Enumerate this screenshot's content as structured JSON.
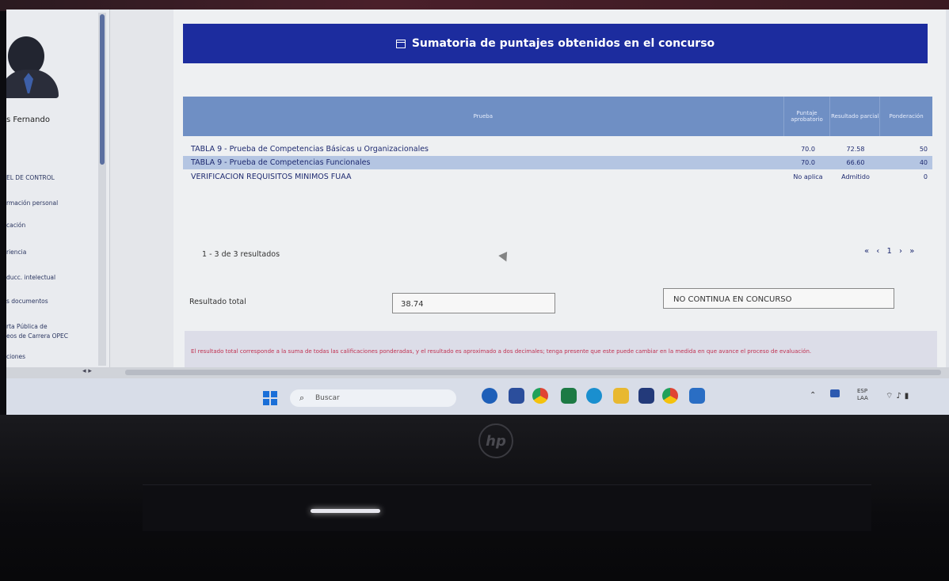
{
  "sidebar": {
    "user_name": "s Fernando",
    "items": [
      "EL DE CONTROL",
      "rmación personal",
      "cación",
      "riencia",
      "ducc. intelectual",
      "s documentos",
      "rta Pública de",
      "eos de Carrera OPEC",
      "ciones"
    ]
  },
  "header": {
    "title": "Sumatoria de puntajes obtenidos en el concurso",
    "icon": "table-icon"
  },
  "table": {
    "columns": [
      "Prueba",
      "Puntaje aprobatorio",
      "Resultado parcial",
      "Ponderación"
    ],
    "rows": [
      {
        "prueba": "TABLA 9 - Prueba de Competencias Básicas u Organizacionales",
        "aprobatorio": "70.0",
        "parcial": "72.58",
        "ponderacion": "50"
      },
      {
        "prueba": "TABLA 9 - Prueba de Competencias Funcionales",
        "aprobatorio": "70.0",
        "parcial": "66.60",
        "ponderacion": "40"
      },
      {
        "prueba": "VERIFICACION REQUISITOS MINIMOS FUAA",
        "aprobatorio": "No aplica",
        "parcial": "Admitido",
        "ponderacion": "0"
      }
    ]
  },
  "pager": {
    "summary": "1 - 3 de 3 resultados",
    "nav": "« ‹ 1 › »"
  },
  "result": {
    "label": "Resultado total",
    "value": "38.74",
    "status": "NO CONTINUA EN CONCURSO"
  },
  "note": "El resultado total corresponde a la suma de todas las calificaciones ponderadas, y el resultado es aproximado a dos decimales; tenga presente que este puede cambiar en la medida en que avance el proceso de evaluación.",
  "taskbar": {
    "search_placeholder": "Buscar",
    "lang": "ESP",
    "lang_sub": "LAA"
  },
  "colors": {
    "header_blue": "#1c2c9e",
    "table_header": "#6f8fc4",
    "note_red": "#c03050"
  }
}
